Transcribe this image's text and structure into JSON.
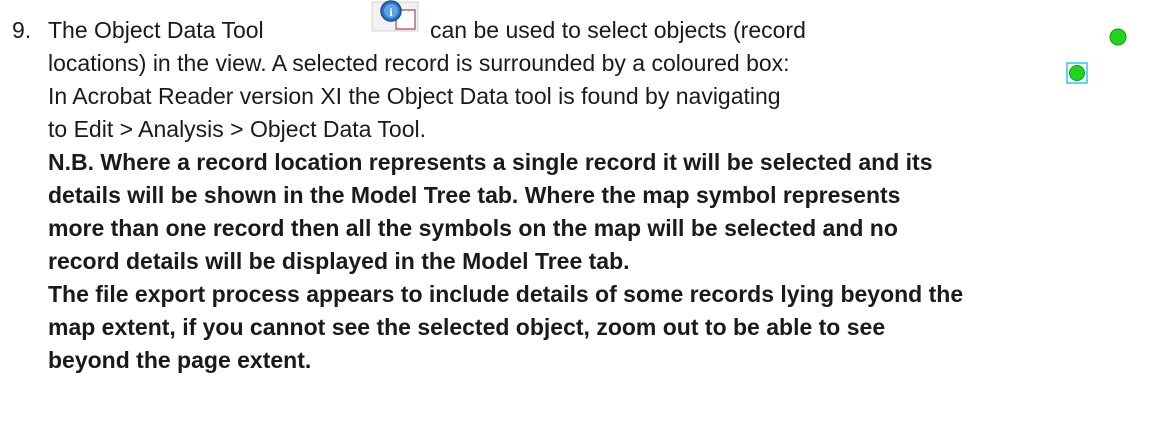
{
  "item": {
    "number": "9.",
    "intro_part1": "The Object Data Tool",
    "intro_part2": "can be used to select objects (record",
    "line2": "locations) in the view. A selected record is surrounded by a coloured box:",
    "line3": "In Acrobat Reader version XI the Object Data tool is found by navigating",
    "line4": "to Edit > Analysis > Object Data Tool.",
    "note_lines": [
      "N.B. Where a record location represents a single record it will be selected and its",
      "details will be shown in the Model Tree tab. Where the map symbol represents",
      "more than one record then all the symbols on the map will be selected and no",
      "record details will be displayed in the Model Tree tab.",
      "The file export process appears to include details of some records lying beyond the",
      "map extent, if you cannot see the selected object, zoom out to be able to see",
      "beyond the page extent."
    ]
  },
  "icons": {
    "tool_icon": "object-data-tool-icon",
    "marker_color": "#22d322",
    "selection_box_color": "#2ec7f2"
  }
}
